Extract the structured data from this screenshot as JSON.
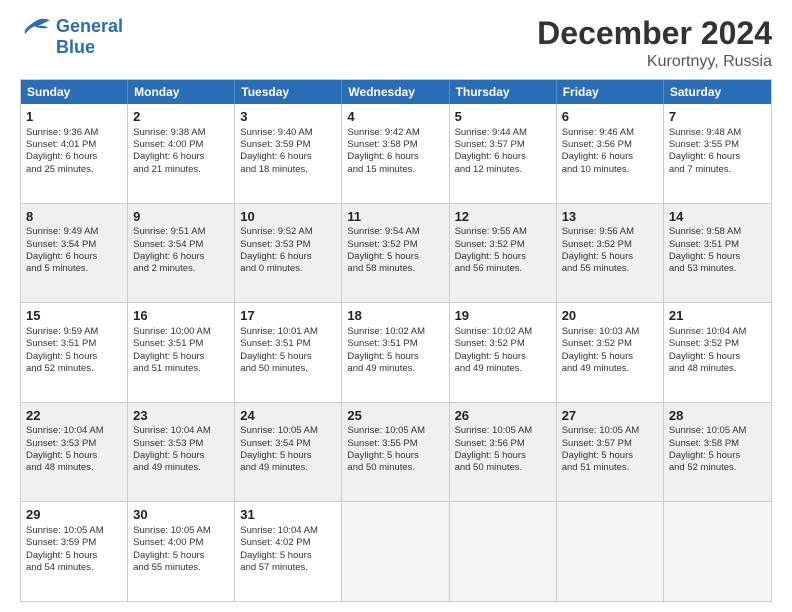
{
  "header": {
    "logo_line1": "General",
    "logo_line2": "Blue",
    "title": "December 2024",
    "subtitle": "Kurortnyy, Russia"
  },
  "weekdays": [
    "Sunday",
    "Monday",
    "Tuesday",
    "Wednesday",
    "Thursday",
    "Friday",
    "Saturday"
  ],
  "rows": [
    [
      {
        "day": "1",
        "lines": [
          "Sunrise: 9:36 AM",
          "Sunset: 4:01 PM",
          "Daylight: 6 hours",
          "and 25 minutes."
        ]
      },
      {
        "day": "2",
        "lines": [
          "Sunrise: 9:38 AM",
          "Sunset: 4:00 PM",
          "Daylight: 6 hours",
          "and 21 minutes."
        ]
      },
      {
        "day": "3",
        "lines": [
          "Sunrise: 9:40 AM",
          "Sunset: 3:59 PM",
          "Daylight: 6 hours",
          "and 18 minutes."
        ]
      },
      {
        "day": "4",
        "lines": [
          "Sunrise: 9:42 AM",
          "Sunset: 3:58 PM",
          "Daylight: 6 hours",
          "and 15 minutes."
        ]
      },
      {
        "day": "5",
        "lines": [
          "Sunrise: 9:44 AM",
          "Sunset: 3:57 PM",
          "Daylight: 6 hours",
          "and 12 minutes."
        ]
      },
      {
        "day": "6",
        "lines": [
          "Sunrise: 9:46 AM",
          "Sunset: 3:56 PM",
          "Daylight: 6 hours",
          "and 10 minutes."
        ]
      },
      {
        "day": "7",
        "lines": [
          "Sunrise: 9:48 AM",
          "Sunset: 3:55 PM",
          "Daylight: 6 hours",
          "and 7 minutes."
        ]
      }
    ],
    [
      {
        "day": "8",
        "lines": [
          "Sunrise: 9:49 AM",
          "Sunset: 3:54 PM",
          "Daylight: 6 hours",
          "and 5 minutes."
        ]
      },
      {
        "day": "9",
        "lines": [
          "Sunrise: 9:51 AM",
          "Sunset: 3:54 PM",
          "Daylight: 6 hours",
          "and 2 minutes."
        ]
      },
      {
        "day": "10",
        "lines": [
          "Sunrise: 9:52 AM",
          "Sunset: 3:53 PM",
          "Daylight: 6 hours",
          "and 0 minutes."
        ]
      },
      {
        "day": "11",
        "lines": [
          "Sunrise: 9:54 AM",
          "Sunset: 3:52 PM",
          "Daylight: 5 hours",
          "and 58 minutes."
        ]
      },
      {
        "day": "12",
        "lines": [
          "Sunrise: 9:55 AM",
          "Sunset: 3:52 PM",
          "Daylight: 5 hours",
          "and 56 minutes."
        ]
      },
      {
        "day": "13",
        "lines": [
          "Sunrise: 9:56 AM",
          "Sunset: 3:52 PM",
          "Daylight: 5 hours",
          "and 55 minutes."
        ]
      },
      {
        "day": "14",
        "lines": [
          "Sunrise: 9:58 AM",
          "Sunset: 3:51 PM",
          "Daylight: 5 hours",
          "and 53 minutes."
        ]
      }
    ],
    [
      {
        "day": "15",
        "lines": [
          "Sunrise: 9:59 AM",
          "Sunset: 3:51 PM",
          "Daylight: 5 hours",
          "and 52 minutes."
        ]
      },
      {
        "day": "16",
        "lines": [
          "Sunrise: 10:00 AM",
          "Sunset: 3:51 PM",
          "Daylight: 5 hours",
          "and 51 minutes."
        ]
      },
      {
        "day": "17",
        "lines": [
          "Sunrise: 10:01 AM",
          "Sunset: 3:51 PM",
          "Daylight: 5 hours",
          "and 50 minutes."
        ]
      },
      {
        "day": "18",
        "lines": [
          "Sunrise: 10:02 AM",
          "Sunset: 3:51 PM",
          "Daylight: 5 hours",
          "and 49 minutes."
        ]
      },
      {
        "day": "19",
        "lines": [
          "Sunrise: 10:02 AM",
          "Sunset: 3:52 PM",
          "Daylight: 5 hours",
          "and 49 minutes."
        ]
      },
      {
        "day": "20",
        "lines": [
          "Sunrise: 10:03 AM",
          "Sunset: 3:52 PM",
          "Daylight: 5 hours",
          "and 49 minutes."
        ]
      },
      {
        "day": "21",
        "lines": [
          "Sunrise: 10:04 AM",
          "Sunset: 3:52 PM",
          "Daylight: 5 hours",
          "and 48 minutes."
        ]
      }
    ],
    [
      {
        "day": "22",
        "lines": [
          "Sunrise: 10:04 AM",
          "Sunset: 3:53 PM",
          "Daylight: 5 hours",
          "and 48 minutes."
        ]
      },
      {
        "day": "23",
        "lines": [
          "Sunrise: 10:04 AM",
          "Sunset: 3:53 PM",
          "Daylight: 5 hours",
          "and 49 minutes."
        ]
      },
      {
        "day": "24",
        "lines": [
          "Sunrise: 10:05 AM",
          "Sunset: 3:54 PM",
          "Daylight: 5 hours",
          "and 49 minutes."
        ]
      },
      {
        "day": "25",
        "lines": [
          "Sunrise: 10:05 AM",
          "Sunset: 3:55 PM",
          "Daylight: 5 hours",
          "and 50 minutes."
        ]
      },
      {
        "day": "26",
        "lines": [
          "Sunrise: 10:05 AM",
          "Sunset: 3:56 PM",
          "Daylight: 5 hours",
          "and 50 minutes."
        ]
      },
      {
        "day": "27",
        "lines": [
          "Sunrise: 10:05 AM",
          "Sunset: 3:57 PM",
          "Daylight: 5 hours",
          "and 51 minutes."
        ]
      },
      {
        "day": "28",
        "lines": [
          "Sunrise: 10:05 AM",
          "Sunset: 3:58 PM",
          "Daylight: 5 hours",
          "and 52 minutes."
        ]
      }
    ],
    [
      {
        "day": "29",
        "lines": [
          "Sunrise: 10:05 AM",
          "Sunset: 3:59 PM",
          "Daylight: 5 hours",
          "and 54 minutes."
        ]
      },
      {
        "day": "30",
        "lines": [
          "Sunrise: 10:05 AM",
          "Sunset: 4:00 PM",
          "Daylight: 5 hours",
          "and 55 minutes."
        ]
      },
      {
        "day": "31",
        "lines": [
          "Sunrise: 10:04 AM",
          "Sunset: 4:02 PM",
          "Daylight: 5 hours",
          "and 57 minutes."
        ]
      },
      {
        "day": "",
        "lines": []
      },
      {
        "day": "",
        "lines": []
      },
      {
        "day": "",
        "lines": []
      },
      {
        "day": "",
        "lines": []
      }
    ]
  ]
}
